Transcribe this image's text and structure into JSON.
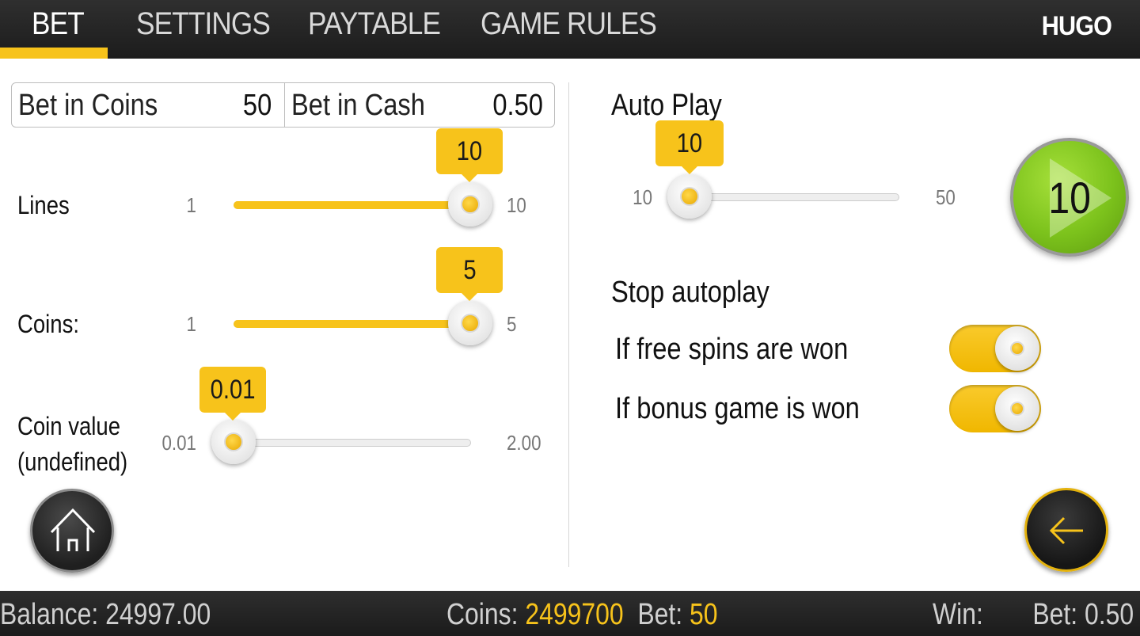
{
  "nav": {
    "tabs": [
      {
        "label": "BET",
        "active": true
      },
      {
        "label": "SETTINGS",
        "active": false
      },
      {
        "label": "PAYTABLE",
        "active": false
      },
      {
        "label": "GAME RULES",
        "active": false
      }
    ],
    "brand": "HUGO",
    "accent_color": "#f7c31b"
  },
  "bet_summary": {
    "coins_label": "Bet in Coins",
    "coins_value": "50",
    "cash_label": "Bet in Cash",
    "cash_value": "0.50"
  },
  "sliders": {
    "lines": {
      "label": "Lines",
      "min": "1",
      "max": "10",
      "value": "10",
      "fraction": 1.0
    },
    "coins": {
      "label": "Coins:",
      "min": "1",
      "max": "5",
      "value": "5",
      "fraction": 1.0
    },
    "coin_value": {
      "label_line1": "Coin value",
      "label_line2": "(undefined)",
      "min": "0.01",
      "max": "2.00",
      "value": "0.01",
      "fraction": 0.0
    }
  },
  "autoplay": {
    "title": "Auto Play",
    "min": "10",
    "max": "50",
    "value": "10",
    "fraction": 0.0,
    "button_count": "10",
    "button_color": "#7cc21c"
  },
  "stop_autoplay": {
    "title": "Stop autoplay",
    "options": [
      {
        "label": "If free spins are won",
        "on": true
      },
      {
        "label": "If bonus game is won",
        "on": true
      }
    ]
  },
  "icons": {
    "home": "home-icon",
    "back": "arrow-left-icon",
    "play": "play-icon"
  },
  "status": {
    "balance_label": "Balance:",
    "balance_value": "24997.00",
    "coins_label": "Coins:",
    "coins_value": "2499700",
    "bet_label": "Bet:",
    "bet_value": "50",
    "win_label": "Win:",
    "win_value": "",
    "bet_cash_label": "Bet:",
    "bet_cash_value": "0.50"
  }
}
